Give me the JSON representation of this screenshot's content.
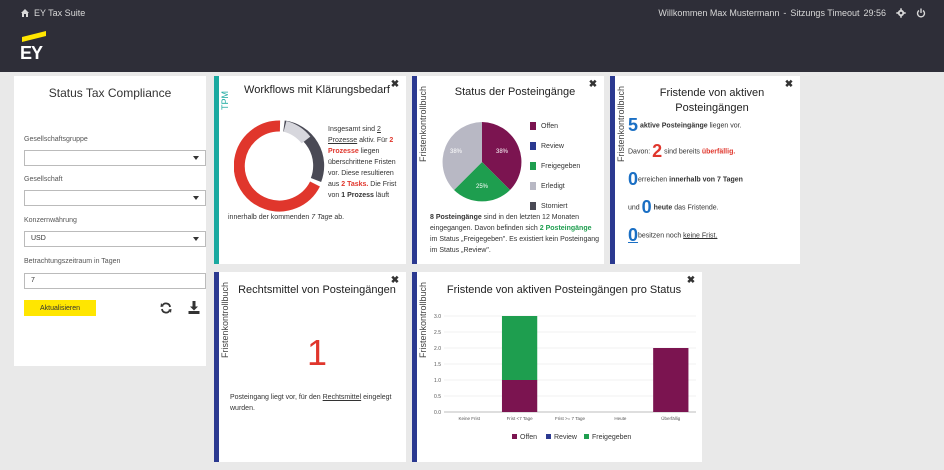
{
  "topbar": {
    "app_title": "EY Tax Suite",
    "welcome": "Willkommen Max Mustermann",
    "separator": "-",
    "timeout_label": "Sitzungs Timeout",
    "timeout_value": "29:56"
  },
  "logo": {
    "text": "EY"
  },
  "sidebar": {
    "title": "Status Tax Compliance",
    "group_label": "Gesellschaftsgruppe",
    "group_value": "",
    "company_label": "Gesellschaft",
    "company_value": "",
    "currency_label": "Konzernwährung",
    "currency_value": "USD",
    "period_label": "Betrachtungszeitraum in Tagen",
    "period_value": "7",
    "update_label": "Aktualisieren"
  },
  "colors": {
    "teal": "#1aa9a0",
    "navy": "#2b3990",
    "purple": "#7b1450",
    "green": "#1e9e4f",
    "gray": "#b8b8c4",
    "red": "#e0362c"
  },
  "workflows": {
    "strip_label": "TPM",
    "title": "Workflows mit Klärungsbedarf",
    "t1": "Insgesamt sind ",
    "t2": "2 Prozesse",
    "t3": " aktiv. Für ",
    "t4": "2 Prozesse",
    "t5": " liegen überschrittene Fristen vor. Diese resultieren aus ",
    "t6": "2 Tasks.",
    "t7": " Die Frist von ",
    "t8": "1 Prozess",
    "t9": " läuft",
    "t10": "innerhalb der kommenden ",
    "t11": "7 Tage",
    "t12": " ab."
  },
  "posteingaenge": {
    "strip_label": "Fristenkontrollbuch",
    "title": "Status der Posteingänge",
    "legend": [
      "Offen",
      "Review",
      "Freigegeben",
      "Erledigt",
      "Storniert"
    ],
    "pie_labels": [
      "38%",
      "25%",
      "38%"
    ],
    "t1": "8 Posteingänge",
    "t2": " sind in den letzten 12 Monaten eingegangen. Davon befinden sich ",
    "t3": "2 Posteingänge",
    "t4": " im Status „Freigegeben\". Es existiert kein Posteingang im Status „Review\"."
  },
  "fristende": {
    "strip_label": "Fristenkontrollbuch",
    "title_line1": "Fristende von aktiven",
    "title_line2": "Posteingängen",
    "n_active": "5",
    "active_text": "aktive Posteingänge",
    "active_suffix": " liegen vor.",
    "davon": "Davon:",
    "n_overdue": "2",
    "overdue_pre": " sind bereits ",
    "overdue_word": "überfällig.",
    "n_week": "0",
    "week_pre": "erreichen ",
    "week_bold": "innerhalb von 7 Tagen",
    "und": "und",
    "n_today": "0",
    "today_bold": "heute",
    "today_suffix": " das Fristende.",
    "n_none": "0",
    "none_pre": "besitzen noch ",
    "none_link": "keine Frist."
  },
  "rechtsmittel": {
    "strip_label": "Fristenkontrollbuch",
    "title": "Rechtsmittel von Posteingängen",
    "number": "1",
    "t1": "Posteingang liegt vor, für den ",
    "t2": "Rechtsmittel",
    "t3": " eingelegt wurden."
  },
  "chart_panel": {
    "strip_label": "Fristenkontrollbuch",
    "title": "Fristende von aktiven Posteingängen pro Status"
  },
  "chart_data": {
    "type": "bar",
    "stacked": true,
    "categories": [
      "Keine Frist",
      "Frist <7 Tage",
      "Frist >= 7 Tage",
      "Heute",
      "Überfällig"
    ],
    "series": [
      {
        "name": "Offen",
        "color": "#7b1450",
        "values": [
          0,
          1,
          0,
          0,
          2
        ]
      },
      {
        "name": "Review",
        "color": "#2b3990",
        "values": [
          0,
          0,
          0,
          0,
          0
        ]
      },
      {
        "name": "Freigegeben",
        "color": "#1e9e4f",
        "values": [
          0,
          2,
          0,
          0,
          0
        ]
      }
    ],
    "y_ticks": [
      "0.0",
      "0.5",
      "1.0",
      "1.5",
      "2.0",
      "2.5",
      "3.0"
    ],
    "ylim": [
      0,
      3
    ],
    "legend_position": "bottom"
  }
}
